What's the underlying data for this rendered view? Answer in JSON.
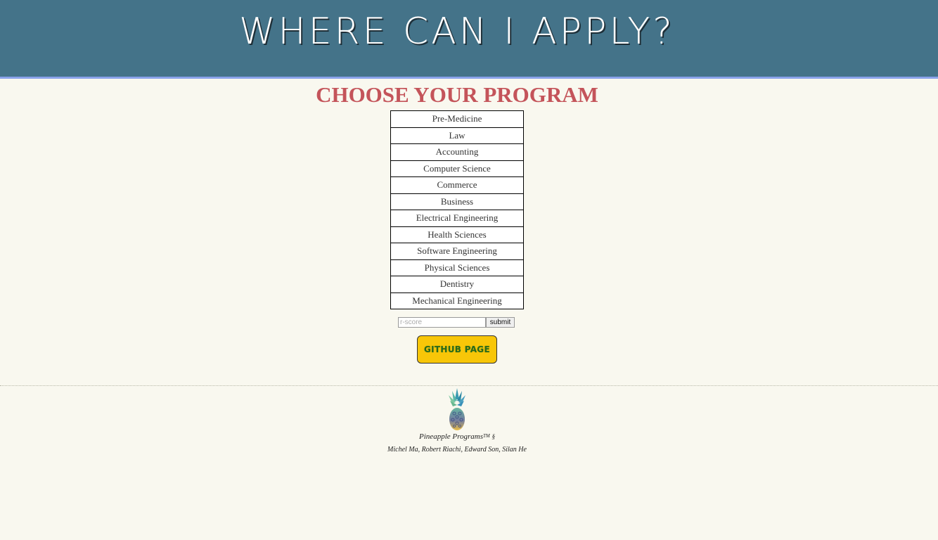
{
  "header": {
    "title": "WHERE CAN I APPLY?"
  },
  "main": {
    "section_title": "CHOOSE YOUR PROGRAM",
    "programs": [
      "Pre-Medicine",
      "Law",
      "Accounting",
      "Computer Science",
      "Commerce",
      "Business",
      "Electrical Engineering",
      "Health Sciences",
      "Software Engineering",
      "Physical Sciences",
      "Dentistry",
      "Mechanical Engineering"
    ],
    "score_form": {
      "placeholder": "r-score",
      "value": "",
      "submit_label": "submit"
    },
    "github_button_label": "GITHUB PAGE"
  },
  "footer": {
    "logo_icon": "pineapple-icon",
    "brand": "Pineapple Programs",
    "trademark": "TM",
    "symbol": "§",
    "authors": "Michel Ma, Robert Riachi, Edward Son, Silan He"
  },
  "colors": {
    "header_bg": "#447389",
    "header_border": "#8aa3ea",
    "page_bg": "#f9f8ef",
    "section_title": "#c4545a",
    "github_button_bg": "#f8c608",
    "github_button_text": "#2a6a1a"
  }
}
